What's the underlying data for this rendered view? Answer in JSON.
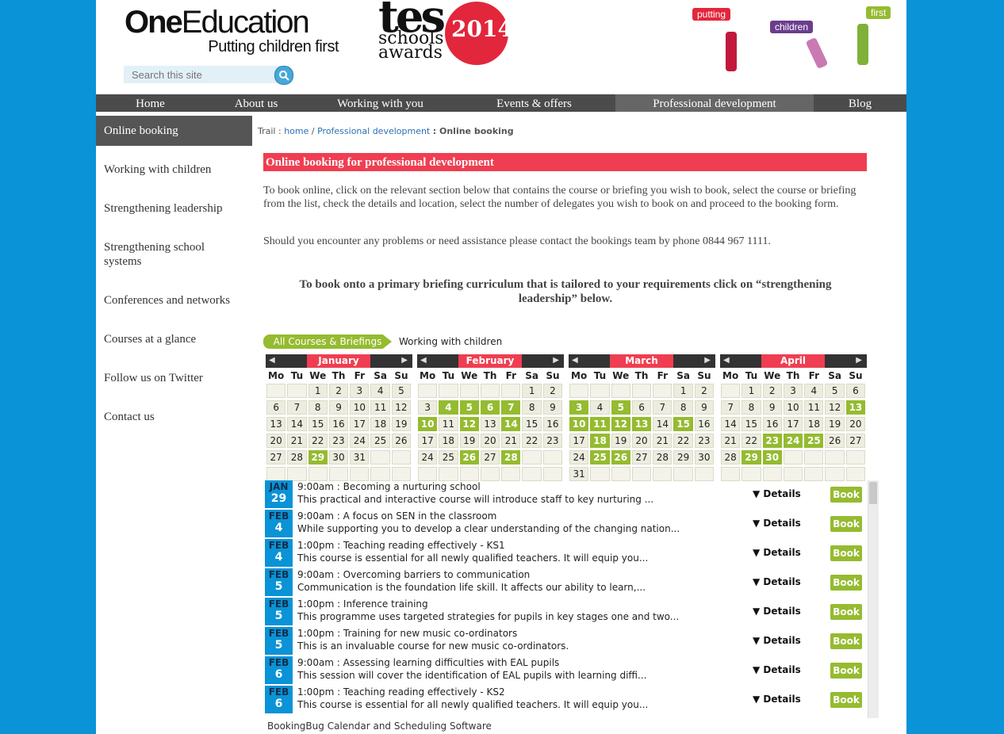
{
  "header": {
    "logo_bold": "One",
    "logo_rest": "Education",
    "tagline": "Putting children first",
    "tes_word": "tes",
    "tes_sub1": "schools",
    "tes_sub2": "awards",
    "tes_year": "2014",
    "bubbles": [
      "putting",
      "children",
      "first"
    ],
    "search": {
      "placeholder": "Search this site",
      "icon": "search-icon"
    }
  },
  "nav": [
    "Home",
    "About us",
    "Working with you",
    "Events & offers",
    "Professional development",
    "Blog"
  ],
  "sidebar": [
    "Online booking",
    "Working with children",
    "Strengthening leadership",
    "Strengthening school systems",
    "Conferences and networks",
    "Courses at a glance",
    "Follow us on Twitter",
    "Contact us"
  ],
  "trail": {
    "label": "Trail :",
    "home": "home",
    "sep": "/",
    "section": "Professional development",
    "current": ": Online booking"
  },
  "page_title": "Online booking for professional development",
  "paragraphs": [
    "To book online, click on the relevant section below that contains the course or briefing you wish to book, select the course or briefing from the list, check the details and location, select the number of delegates you wish to book on and proceed to the booking form.",
    "Should you encounter any problems or need assistance please contact the bookings team by phone 0844 967 1111."
  ],
  "note": "To book onto a primary briefing curriculum that is tailored to your requirements click on “strengthening leadership” below.",
  "booking": {
    "crumb_all": "All Courses & Briefings",
    "crumb_current": "Working with children",
    "dow": [
      "Mo",
      "Tu",
      "We",
      "Th",
      "Fr",
      "Sa",
      "Su"
    ],
    "months": [
      {
        "name": "January",
        "weeks": [
          [
            "",
            "",
            "1",
            "2",
            "3",
            "4",
            "5"
          ],
          [
            "6",
            "7",
            "8",
            "9",
            "10",
            "11",
            "12"
          ],
          [
            "13",
            "14",
            "15",
            "16",
            "17",
            "18",
            "19"
          ],
          [
            "20",
            "21",
            "22",
            "23",
            "24",
            "25",
            "26"
          ],
          [
            "27",
            "28",
            "29",
            "30",
            "31",
            "",
            ""
          ],
          [
            "",
            "",
            "",
            "",
            "",
            "",
            ""
          ]
        ],
        "available": [
          "29"
        ]
      },
      {
        "name": "February",
        "weeks": [
          [
            "",
            "",
            "",
            "",
            "",
            "1",
            "2"
          ],
          [
            "3",
            "4",
            "5",
            "6",
            "7",
            "8",
            "9"
          ],
          [
            "10",
            "11",
            "12",
            "13",
            "14",
            "15",
            "16"
          ],
          [
            "17",
            "18",
            "19",
            "20",
            "21",
            "22",
            "23"
          ],
          [
            "24",
            "25",
            "26",
            "27",
            "28",
            "",
            ""
          ],
          [
            "",
            "",
            "",
            "",
            "",
            "",
            ""
          ]
        ],
        "available": [
          "4",
          "5",
          "6",
          "7",
          "10",
          "12",
          "14",
          "26",
          "28"
        ]
      },
      {
        "name": "March",
        "weeks": [
          [
            "",
            "",
            "",
            "",
            "",
            "1",
            "2"
          ],
          [
            "3",
            "4",
            "5",
            "6",
            "7",
            "8",
            "9"
          ],
          [
            "10",
            "11",
            "12",
            "13",
            "14",
            "15",
            "16"
          ],
          [
            "17",
            "18",
            "19",
            "20",
            "21",
            "22",
            "23"
          ],
          [
            "24",
            "25",
            "26",
            "27",
            "28",
            "29",
            "30"
          ],
          [
            "31",
            "",
            "",
            "",
            "",
            "",
            ""
          ]
        ],
        "available": [
          "3",
          "5",
          "10",
          "11",
          "12",
          "13",
          "15",
          "18",
          "25",
          "26"
        ]
      },
      {
        "name": "April",
        "weeks": [
          [
            "",
            "1",
            "2",
            "3",
            "4",
            "5",
            "6"
          ],
          [
            "7",
            "8",
            "9",
            "10",
            "11",
            "12",
            "13"
          ],
          [
            "14",
            "15",
            "16",
            "17",
            "18",
            "19",
            "20"
          ],
          [
            "21",
            "22",
            "23",
            "24",
            "25",
            "26",
            "27"
          ],
          [
            "28",
            "29",
            "30",
            "",
            "",
            "",
            ""
          ],
          [
            "",
            "",
            "",
            "",
            "",
            "",
            ""
          ]
        ],
        "available": [
          "13",
          "23",
          "24",
          "25",
          "29",
          "30"
        ]
      }
    ],
    "events": [
      {
        "month": "JAN",
        "day": "29",
        "title": "9:00am : Becoming a nurturing school",
        "desc": "This practical and interactive course will introduce staff to key nurturing ...",
        "details": "▼ Details",
        "book": "Book"
      },
      {
        "month": "FEB",
        "day": "4",
        "title": "9:00am : A focus on SEN in the classroom",
        "desc": "While supporting you to develop a clear understanding of the changing nation...",
        "details": "▼ Details",
        "book": "Book"
      },
      {
        "month": "FEB",
        "day": "4",
        "title": "1:00pm : Teaching reading effectively - KS1",
        "desc": "This course is essential for all newly qualified teachers. It will equip you...",
        "details": "▼ Details",
        "book": "Book"
      },
      {
        "month": "FEB",
        "day": "5",
        "title": "9:00am : Overcoming barriers to communication",
        "desc": "Communication is the foundation life skill. It affects our ability to learn,...",
        "details": "▼ Details",
        "book": "Book"
      },
      {
        "month": "FEB",
        "day": "5",
        "title": "1:00pm : Inference training",
        "desc": "This programme uses targeted strategies for pupils in key stages one and two...",
        "details": "▼ Details",
        "book": "Book"
      },
      {
        "month": "FEB",
        "day": "5",
        "title": "1:00pm : Training for new music co-ordinators",
        "desc": "This is an invaluable course for new music co-ordinators.",
        "details": "▼ Details",
        "book": "Book"
      },
      {
        "month": "FEB",
        "day": "6",
        "title": "9:00am : Assessing learning difficulties with EAL pupils",
        "desc": "This session will cover the identification of EAL pupils with learning diffi...",
        "details": "▼ Details",
        "book": "Book"
      },
      {
        "month": "FEB",
        "day": "6",
        "title": "1:00pm : Teaching reading effectively - KS2",
        "desc": "This course is essential for all newly qualified teachers. It will equip you...",
        "details": "▼ Details",
        "book": "Book"
      }
    ],
    "footer": "BookingBug Calendar and Scheduling Software"
  },
  "colors": {
    "page_bg": "#0a93d6",
    "accent_red": "#ef3e51",
    "accent_green": "#95bb30",
    "nav_bg": "#4b4b4b"
  }
}
